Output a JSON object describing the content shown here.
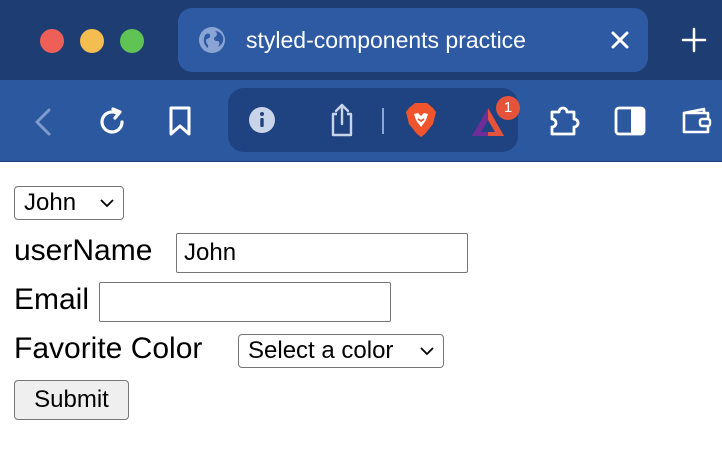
{
  "browser": {
    "tab": {
      "title": "styled-components practice"
    },
    "toolbar": {
      "notification_count": "1"
    }
  },
  "form": {
    "user_select": {
      "selected": "John"
    },
    "username": {
      "label": "userName",
      "value": "John"
    },
    "email": {
      "label": "Email",
      "value": ""
    },
    "favorite_color": {
      "label": "Favorite Color",
      "selected": "Select a color"
    },
    "submit_label": "Submit"
  }
}
